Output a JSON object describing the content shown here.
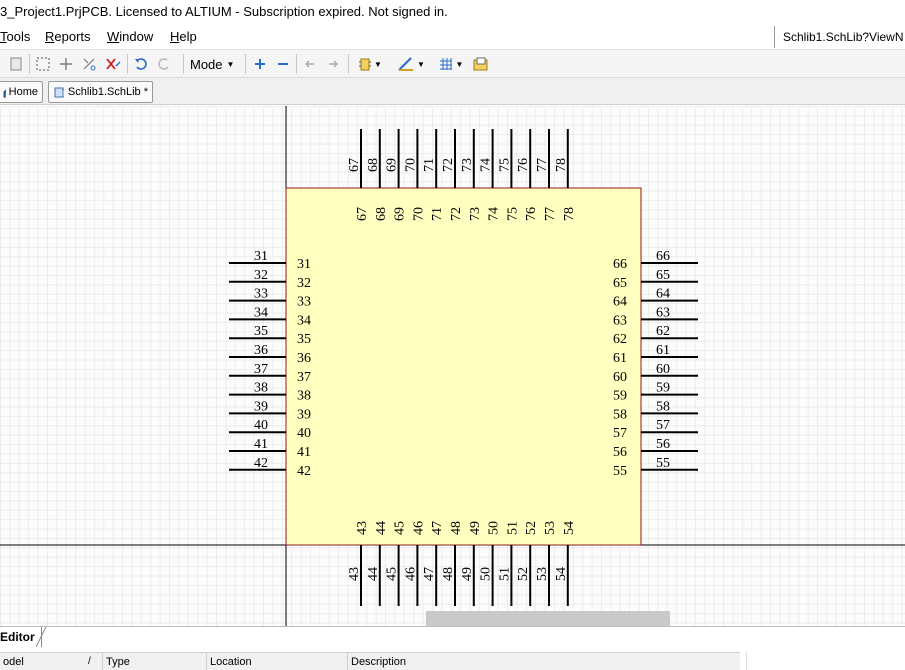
{
  "window": {
    "title": "3_Project1.PrjPCB. Licensed to ALTIUM - Subscription expired. Not signed in."
  },
  "menu": {
    "items": [
      {
        "label": "Tools",
        "underline": "T",
        "rest": "ools"
      },
      {
        "label": "Reports",
        "underline": "R",
        "rest": "eports"
      },
      {
        "label": "Window",
        "underline": "W",
        "rest": "indow"
      },
      {
        "label": "Help",
        "underline": "H",
        "rest": "elp"
      }
    ],
    "path": "Schlib1.SchLib?ViewN"
  },
  "toolbar": {
    "mode_label": "Mode",
    "icons": [
      "paste-icon",
      "select-rect-icon",
      "move-icon",
      "cut-wire-icon",
      "clear-icon",
      "undo-icon",
      "redo-icon",
      "zoom-in-icon",
      "zoom-out-icon",
      "nav-back-icon",
      "nav-forward-icon",
      "component-icon",
      "wire-tool-icon",
      "grid-icon",
      "folder-icon"
    ]
  },
  "tabs": [
    {
      "label": "Home"
    },
    {
      "label": "Schlib1.SchLib *"
    }
  ],
  "component": {
    "body_fill": "#ffffc0",
    "body_stroke": "#8b1a1a",
    "pins_top": [
      "67",
      "68",
      "69",
      "70",
      "71",
      "72",
      "73",
      "74",
      "75",
      "76",
      "77",
      "78"
    ],
    "pins_bottom": [
      "43",
      "44",
      "45",
      "46",
      "47",
      "48",
      "49",
      "50",
      "51",
      "52",
      "53",
      "54"
    ],
    "pins_left": [
      "31",
      "32",
      "33",
      "34",
      "35",
      "36",
      "37",
      "38",
      "39",
      "40",
      "41",
      "42"
    ],
    "pins_right": [
      "66",
      "65",
      "64",
      "63",
      "62",
      "61",
      "60",
      "59",
      "58",
      "57",
      "56",
      "55"
    ]
  },
  "panel": {
    "editor_tab": "Editor",
    "columns": [
      "odel",
      "Type",
      "Location",
      "Description"
    ]
  }
}
